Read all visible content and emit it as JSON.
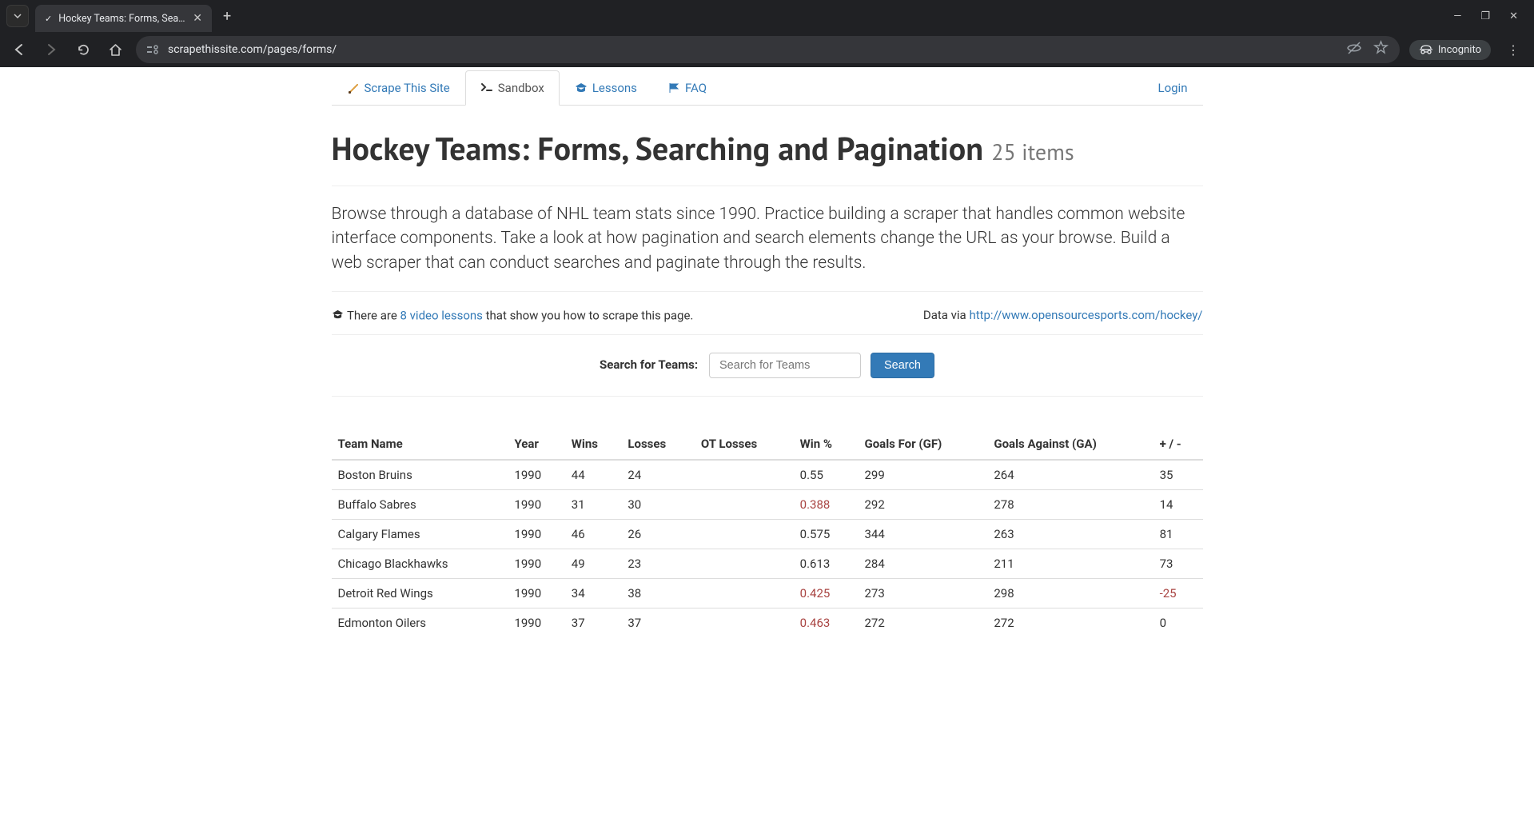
{
  "browser": {
    "tab_title": "Hockey Teams: Forms, Searchin…",
    "url": "scrapethissite.com/pages/forms/",
    "incognito_label": "Incognito"
  },
  "nav": {
    "brand": "Scrape This Site",
    "sandbox": "Sandbox",
    "lessons": "Lessons",
    "faq": "FAQ",
    "login": "Login"
  },
  "page": {
    "title": "Hockey Teams: Forms, Searching and Pagination",
    "subtitle": "25 items",
    "lead": "Browse through a database of NHL team stats since 1990. Practice building a scraper that handles common website interface components. Take a look at how pagination and search elements change the URL as your browse. Build a web scraper that can conduct searches and paginate through the results.",
    "lessons_prefix": "There are ",
    "lessons_link": "8 video lessons",
    "lessons_suffix": " that show you how to scrape this page.",
    "data_via_prefix": "Data via ",
    "data_via_link": "http://www.opensourcesports.com/hockey/"
  },
  "search": {
    "label": "Search for Teams:",
    "placeholder": "Search for Teams",
    "button": "Search"
  },
  "table": {
    "headers": {
      "name": "Team Name",
      "year": "Year",
      "wins": "Wins",
      "losses": "Losses",
      "ot_losses": "OT Losses",
      "win_pct": "Win %",
      "gf": "Goals For (GF)",
      "ga": "Goals Against (GA)",
      "diff": "+ / -"
    },
    "rows": [
      {
        "name": "Boston Bruins",
        "year": "1990",
        "wins": "44",
        "losses": "24",
        "ot_losses": "",
        "win_pct": "0.55",
        "gf": "299",
        "ga": "264",
        "diff": "35",
        "pct_bad": false,
        "diff_bad": false
      },
      {
        "name": "Buffalo Sabres",
        "year": "1990",
        "wins": "31",
        "losses": "30",
        "ot_losses": "",
        "win_pct": "0.388",
        "gf": "292",
        "ga": "278",
        "diff": "14",
        "pct_bad": true,
        "diff_bad": false
      },
      {
        "name": "Calgary Flames",
        "year": "1990",
        "wins": "46",
        "losses": "26",
        "ot_losses": "",
        "win_pct": "0.575",
        "gf": "344",
        "ga": "263",
        "diff": "81",
        "pct_bad": false,
        "diff_bad": false
      },
      {
        "name": "Chicago Blackhawks",
        "year": "1990",
        "wins": "49",
        "losses": "23",
        "ot_losses": "",
        "win_pct": "0.613",
        "gf": "284",
        "ga": "211",
        "diff": "73",
        "pct_bad": false,
        "diff_bad": false
      },
      {
        "name": "Detroit Red Wings",
        "year": "1990",
        "wins": "34",
        "losses": "38",
        "ot_losses": "",
        "win_pct": "0.425",
        "gf": "273",
        "ga": "298",
        "diff": "-25",
        "pct_bad": true,
        "diff_bad": true
      },
      {
        "name": "Edmonton Oilers",
        "year": "1990",
        "wins": "37",
        "losses": "37",
        "ot_losses": "",
        "win_pct": "0.463",
        "gf": "272",
        "ga": "272",
        "diff": "0",
        "pct_bad": true,
        "diff_bad": false
      }
    ]
  }
}
